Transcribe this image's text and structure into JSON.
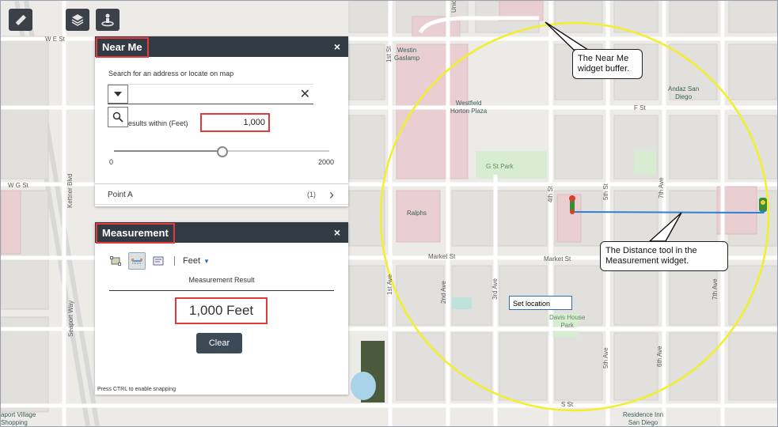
{
  "toolbar": {
    "ruler_icon": "ruler-icon",
    "layers_icon": "layers-icon",
    "locate_icon": "locate-person-icon"
  },
  "map": {
    "streets": {
      "we_st": "W E St",
      "wg_st": "W G St",
      "kettner": "Kettner Blvd",
      "first_st": "1st St",
      "first_ave": "1st Ave",
      "second_ave": "2nd Ave",
      "third_ave": "3rd Ave",
      "fourth_st": "4th St",
      "fifth_st": "5th St",
      "fifth_ave": "5th Ave",
      "sixth_ave": "6th Ave",
      "seventh_ave": "7th Ave",
      "f_st": "F St",
      "market_st_left": "Market St",
      "market_st_right": "Market St",
      "s_st": "S St",
      "unio": "Unio",
      "seaport_way": "Seaport Way"
    },
    "places": {
      "westin": "Westin\nGaslamp",
      "westfield": "Westfield\nHorton Plaza",
      "andaz": "Andaz San\nDiego",
      "g_st_park": "G St Park",
      "ralphs": "Ralphs",
      "davis_house": "Davis House\nPark",
      "residence_inn": "Residence Inn\nSan Diego",
      "seaport_village": "aport Village\nShopping"
    },
    "set_location": "Set location",
    "buffer_color": "#f2ef2c",
    "measure_line_color": "#2f7fd4"
  },
  "near_me": {
    "title": "Near Me",
    "close": "×",
    "search_label": "Search for an address or locate on map",
    "clear_symbol": "✕",
    "results_label": "esults within (Feet)",
    "distance": "1,000",
    "slider_min": "0",
    "slider_max": "2000",
    "slider_fraction": 0.5,
    "point_label": "Point A",
    "point_count": "(1)",
    "chevron": "›"
  },
  "measurement": {
    "title": "Measurement",
    "close": "×",
    "unit": "Feet",
    "caret": "▼",
    "result_label": "Measurement Result",
    "result": "1,000 Feet",
    "clear_label": "Clear",
    "snap_note": "Press CTRL to enable snapping",
    "tools": [
      "area-tool-icon",
      "distance-tool-icon",
      "location-tool-icon"
    ]
  },
  "callouts": {
    "buffer": "The Near Me\nwidget buffer.",
    "distance": "The Distance tool in the\nMeasurement widget."
  },
  "colors": {
    "header_bg": "#323a44",
    "highlight": "#e23b3b",
    "button_bg": "#3c4a58"
  }
}
